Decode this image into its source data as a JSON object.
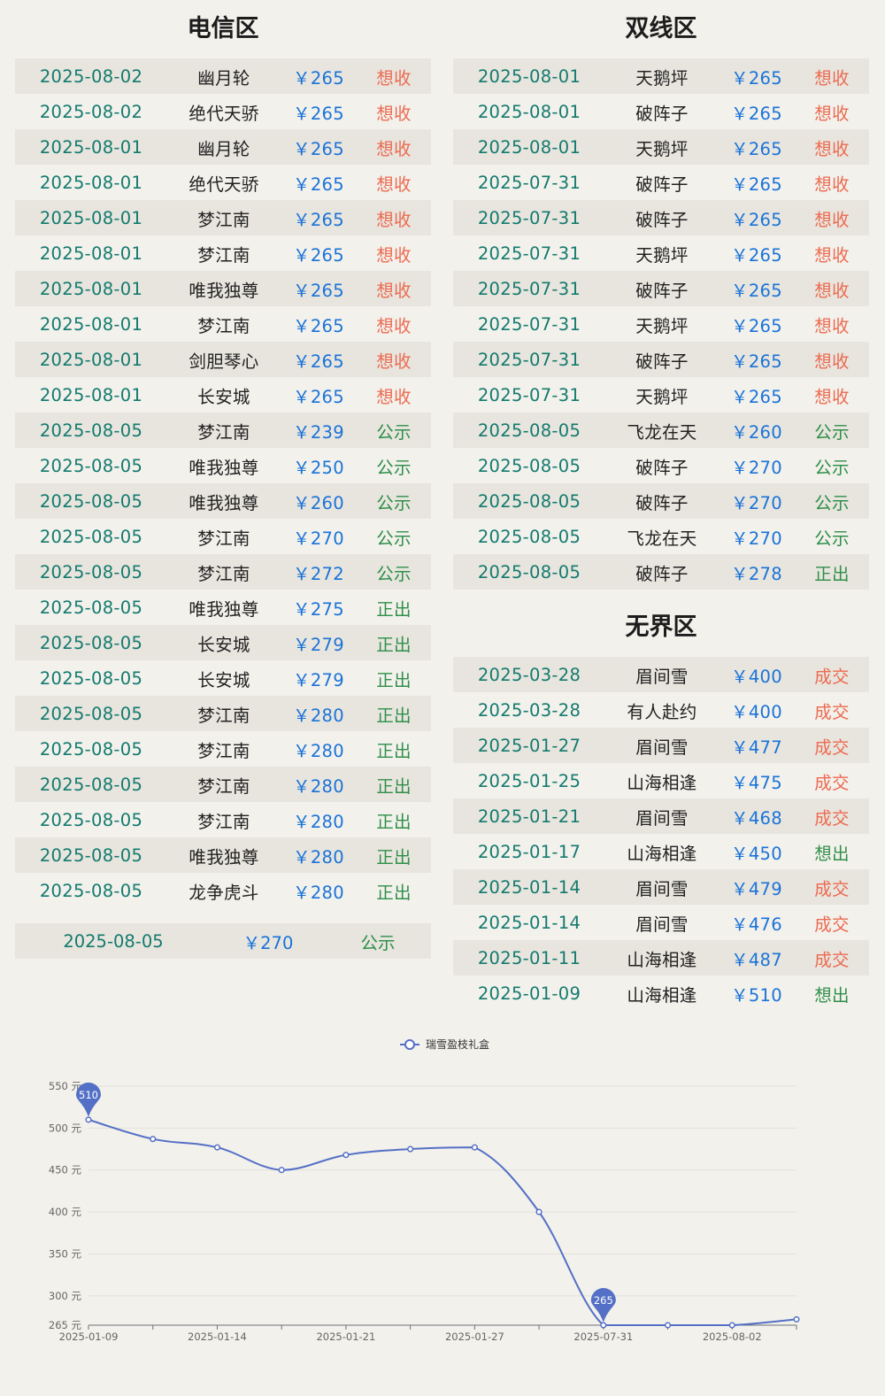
{
  "sections": {
    "telecom": {
      "title": "电信区",
      "rows": [
        {
          "date": "2025-08-02",
          "server": "幽月轮",
          "price": "￥265",
          "status": "想收",
          "kind": "want"
        },
        {
          "date": "2025-08-02",
          "server": "绝代天骄",
          "price": "￥265",
          "status": "想收",
          "kind": "want"
        },
        {
          "date": "2025-08-01",
          "server": "幽月轮",
          "price": "￥265",
          "status": "想收",
          "kind": "want"
        },
        {
          "date": "2025-08-01",
          "server": "绝代天骄",
          "price": "￥265",
          "status": "想收",
          "kind": "want"
        },
        {
          "date": "2025-08-01",
          "server": "梦江南",
          "price": "￥265",
          "status": "想收",
          "kind": "want"
        },
        {
          "date": "2025-08-01",
          "server": "梦江南",
          "price": "￥265",
          "status": "想收",
          "kind": "want"
        },
        {
          "date": "2025-08-01",
          "server": "唯我独尊",
          "price": "￥265",
          "status": "想收",
          "kind": "want"
        },
        {
          "date": "2025-08-01",
          "server": "梦江南",
          "price": "￥265",
          "status": "想收",
          "kind": "want"
        },
        {
          "date": "2025-08-01",
          "server": "剑胆琴心",
          "price": "￥265",
          "status": "想收",
          "kind": "want"
        },
        {
          "date": "2025-08-01",
          "server": "长安城",
          "price": "￥265",
          "status": "想收",
          "kind": "want"
        },
        {
          "date": "2025-08-05",
          "server": "梦江南",
          "price": "￥239",
          "status": "公示",
          "kind": "pub"
        },
        {
          "date": "2025-08-05",
          "server": "唯我独尊",
          "price": "￥250",
          "status": "公示",
          "kind": "pub"
        },
        {
          "date": "2025-08-05",
          "server": "唯我独尊",
          "price": "￥260",
          "status": "公示",
          "kind": "pub"
        },
        {
          "date": "2025-08-05",
          "server": "梦江南",
          "price": "￥270",
          "status": "公示",
          "kind": "pub"
        },
        {
          "date": "2025-08-05",
          "server": "梦江南",
          "price": "￥272",
          "status": "公示",
          "kind": "pub"
        },
        {
          "date": "2025-08-05",
          "server": "唯我独尊",
          "price": "￥275",
          "status": "正出",
          "kind": "sell"
        },
        {
          "date": "2025-08-05",
          "server": "长安城",
          "price": "￥279",
          "status": "正出",
          "kind": "sell"
        },
        {
          "date": "2025-08-05",
          "server": "长安城",
          "price": "￥279",
          "status": "正出",
          "kind": "sell"
        },
        {
          "date": "2025-08-05",
          "server": "梦江南",
          "price": "￥280",
          "status": "正出",
          "kind": "sell"
        },
        {
          "date": "2025-08-05",
          "server": "梦江南",
          "price": "￥280",
          "status": "正出",
          "kind": "sell"
        },
        {
          "date": "2025-08-05",
          "server": "梦江南",
          "price": "￥280",
          "status": "正出",
          "kind": "sell"
        },
        {
          "date": "2025-08-05",
          "server": "梦江南",
          "price": "￥280",
          "status": "正出",
          "kind": "sell"
        },
        {
          "date": "2025-08-05",
          "server": "唯我独尊",
          "price": "￥280",
          "status": "正出",
          "kind": "sell"
        },
        {
          "date": "2025-08-05",
          "server": "龙争虎斗",
          "price": "￥280",
          "status": "正出",
          "kind": "sell"
        }
      ],
      "summary": {
        "date": "2025-08-05",
        "price": "￥270",
        "status": "公示"
      }
    },
    "dual": {
      "title": "双线区",
      "rows": [
        {
          "date": "2025-08-01",
          "server": "天鹅坪",
          "price": "￥265",
          "status": "想收",
          "kind": "want"
        },
        {
          "date": "2025-08-01",
          "server": "破阵子",
          "price": "￥265",
          "status": "想收",
          "kind": "want"
        },
        {
          "date": "2025-08-01",
          "server": "天鹅坪",
          "price": "￥265",
          "status": "想收",
          "kind": "want"
        },
        {
          "date": "2025-07-31",
          "server": "破阵子",
          "price": "￥265",
          "status": "想收",
          "kind": "want"
        },
        {
          "date": "2025-07-31",
          "server": "破阵子",
          "price": "￥265",
          "status": "想收",
          "kind": "want"
        },
        {
          "date": "2025-07-31",
          "server": "天鹅坪",
          "price": "￥265",
          "status": "想收",
          "kind": "want"
        },
        {
          "date": "2025-07-31",
          "server": "破阵子",
          "price": "￥265",
          "status": "想收",
          "kind": "want"
        },
        {
          "date": "2025-07-31",
          "server": "天鹅坪",
          "price": "￥265",
          "status": "想收",
          "kind": "want"
        },
        {
          "date": "2025-07-31",
          "server": "破阵子",
          "price": "￥265",
          "status": "想收",
          "kind": "want"
        },
        {
          "date": "2025-07-31",
          "server": "天鹅坪",
          "price": "￥265",
          "status": "想收",
          "kind": "want"
        },
        {
          "date": "2025-08-05",
          "server": "飞龙在天",
          "price": "￥260",
          "status": "公示",
          "kind": "pub"
        },
        {
          "date": "2025-08-05",
          "server": "破阵子",
          "price": "￥270",
          "status": "公示",
          "kind": "pub"
        },
        {
          "date": "2025-08-05",
          "server": "破阵子",
          "price": "￥270",
          "status": "公示",
          "kind": "pub"
        },
        {
          "date": "2025-08-05",
          "server": "飞龙在天",
          "price": "￥270",
          "status": "公示",
          "kind": "pub"
        },
        {
          "date": "2025-08-05",
          "server": "破阵子",
          "price": "￥278",
          "status": "正出",
          "kind": "sell"
        }
      ]
    },
    "boundless": {
      "title": "无界区",
      "rows": [
        {
          "date": "2025-03-28",
          "server": "眉间雪",
          "price": "￥400",
          "status": "成交",
          "kind": "deal"
        },
        {
          "date": "2025-03-28",
          "server": "有人赴约",
          "price": "￥400",
          "status": "成交",
          "kind": "deal"
        },
        {
          "date": "2025-01-27",
          "server": "眉间雪",
          "price": "￥477",
          "status": "成交",
          "kind": "deal"
        },
        {
          "date": "2025-01-25",
          "server": "山海相逢",
          "price": "￥475",
          "status": "成交",
          "kind": "deal"
        },
        {
          "date": "2025-01-21",
          "server": "眉间雪",
          "price": "￥468",
          "status": "成交",
          "kind": "deal"
        },
        {
          "date": "2025-01-17",
          "server": "山海相逢",
          "price": "￥450",
          "status": "想出",
          "kind": "wantsell"
        },
        {
          "date": "2025-01-14",
          "server": "眉间雪",
          "price": "￥479",
          "status": "成交",
          "kind": "deal"
        },
        {
          "date": "2025-01-14",
          "server": "眉间雪",
          "price": "￥476",
          "status": "成交",
          "kind": "deal"
        },
        {
          "date": "2025-01-11",
          "server": "山海相逢",
          "price": "￥487",
          "status": "成交",
          "kind": "deal"
        },
        {
          "date": "2025-01-09",
          "server": "山海相逢",
          "price": "￥510",
          "status": "想出",
          "kind": "wantsell"
        }
      ]
    }
  },
  "colors": {
    "want": "#ec6a50",
    "pub": "#2f8f4a",
    "sell": "#2f8f4a",
    "deal": "#ec6a50",
    "wantsell": "#2f8f4a",
    "series": "#5470c6",
    "date": "#137a6e",
    "price": "#1a73d8"
  },
  "chart_data": {
    "type": "line",
    "series": [
      {
        "name": "瑞雪盈枝礼盒",
        "x": [
          "2025-01-09",
          "2025-01-11",
          "2025-01-14",
          "2025-01-17",
          "2025-01-21",
          "2025-01-25",
          "2025-01-27",
          "2025-03-28",
          "2025-07-31",
          "2025-08-01",
          "2025-08-02",
          "2025-08-05"
        ],
        "values": [
          510,
          487,
          477,
          450,
          468,
          475,
          477,
          400,
          265,
          265,
          265,
          272
        ]
      }
    ],
    "x_tick_labels": [
      "2025-01-09",
      "2025-01-14",
      "2025-01-21",
      "2025-01-27",
      "2025-07-31",
      "2025-08-02"
    ],
    "y_ticks": [
      265,
      300,
      350,
      400,
      450,
      500,
      550
    ],
    "y_unit": "元",
    "ylim": [
      265,
      550
    ],
    "markers": [
      {
        "label": "510",
        "value": 510
      },
      {
        "label": "265",
        "value": 265
      }
    ],
    "grid": true,
    "legend": "top-center"
  }
}
